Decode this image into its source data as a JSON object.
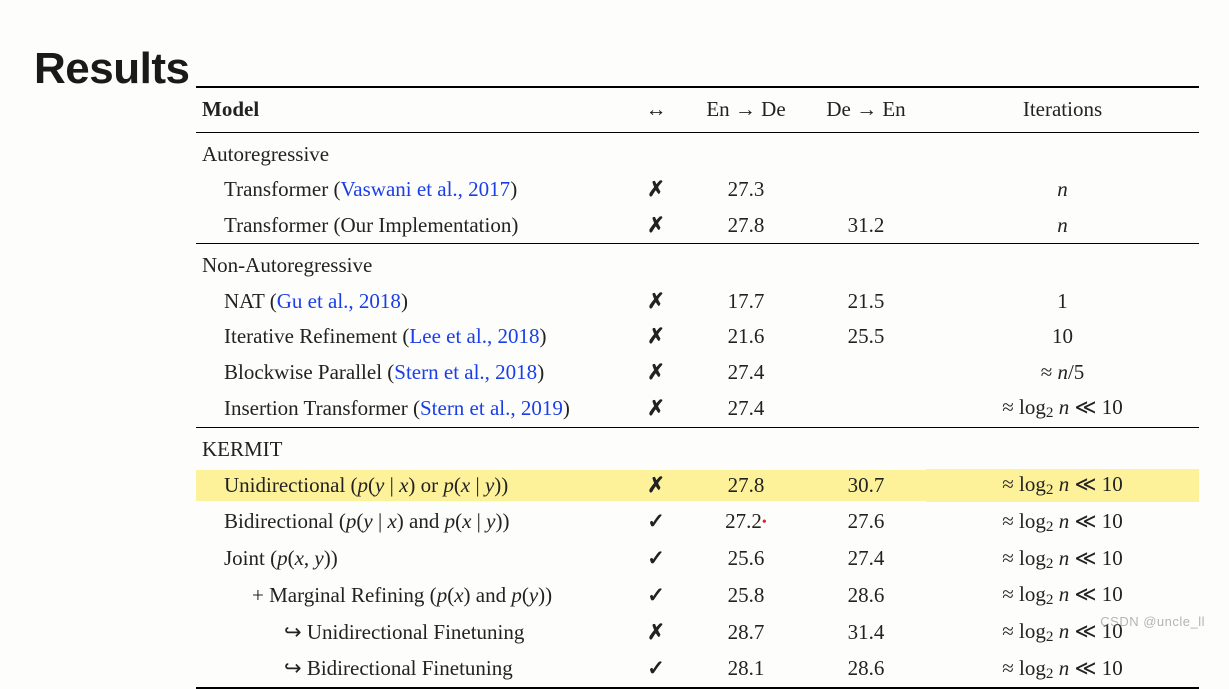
{
  "title": "Results",
  "headers": {
    "model": "Model",
    "sym": "↔",
    "ende": "En → De",
    "deen": "De → En",
    "iter": "Iterations"
  },
  "sections": {
    "autoreg": "Autoregressive",
    "nonautoreg": "Non-Autoregressive",
    "kermit": "KERMIT"
  },
  "rows": {
    "vaswani": {
      "prefix": "Transformer (",
      "cite": "Vaswani et al., 2017",
      "suffix": ")",
      "sym": "✗",
      "ende": "27.3",
      "deen": "",
      "iter": "n"
    },
    "ourimpl": {
      "text": "Transformer (Our Implementation)",
      "sym": "✗",
      "ende": "27.8",
      "deen": "31.2",
      "iter": "n"
    },
    "nat": {
      "prefix": "NAT (",
      "cite": "Gu et al., 2018",
      "suffix": ")",
      "sym": "✗",
      "ende": "17.7",
      "deen": "21.5",
      "iter": "1"
    },
    "iterref": {
      "prefix": "Iterative Refinement (",
      "cite": "Lee et al., 2018",
      "suffix": ")",
      "sym": "✗",
      "ende": "21.6",
      "deen": "25.5",
      "iter": "10"
    },
    "blockwise": {
      "prefix": "Blockwise Parallel (",
      "cite": "Stern et al., 2018",
      "suffix": ")",
      "sym": "✗",
      "ende": "27.4",
      "deen": "",
      "iter_html": "≈ <span class=\"math\">n</span>/5"
    },
    "instrans": {
      "prefix": "Insertion Transformer (",
      "cite": "Stern et al., 2019",
      "suffix": ")",
      "sym": "✗",
      "ende": "27.4",
      "deen": "",
      "iter_html": "≈ log<span class=\"sub\">2</span> <span class=\"math\">n</span> ≪ 10"
    },
    "uni": {
      "label_html": "Unidirectional (<span class=\"math\">p</span>(<span class=\"math\">y</span> | <span class=\"math\">x</span>) or <span class=\"math\">p</span>(<span class=\"math\">x</span> | <span class=\"math\">y</span>))",
      "sym": "✗",
      "ende": "27.8",
      "deen": "30.7",
      "iter_html": "≈ log<span class=\"sub\">2</span> <span class=\"math\">n</span> ≪ 10"
    },
    "bi": {
      "label_html": "Bidirectional (<span class=\"math\">p</span>(<span class=\"math\">y</span> | <span class=\"math\">x</span>) and <span class=\"math\">p</span>(<span class=\"math\">x</span> | <span class=\"math\">y</span>))",
      "sym": "✓",
      "ende": "27.2",
      "deen": "27.6",
      "iter_html": "≈ log<span class=\"sub\">2</span> <span class=\"math\">n</span> ≪ 10"
    },
    "joint": {
      "label_html": "Joint (<span class=\"math\">p</span>(<span class=\"math\">x</span>, <span class=\"math\">y</span>))",
      "sym": "✓",
      "ende": "25.6",
      "deen": "27.4",
      "iter_html": "≈ log<span class=\"sub\">2</span> <span class=\"math\">n</span> ≪ 10"
    },
    "marginal": {
      "label_html": "+ Marginal Refining (<span class=\"math\">p</span>(<span class=\"math\">x</span>) and <span class=\"math\">p</span>(<span class=\"math\">y</span>))",
      "sym": "✓",
      "ende": "25.8",
      "deen": "28.6",
      "iter_html": "≈ log<span class=\"sub\">2</span> <span class=\"math\">n</span> ≪ 10"
    },
    "unift": {
      "text": "↪ Unidirectional Finetuning",
      "sym": "✗",
      "ende": "28.7",
      "deen": "31.4",
      "iter_html": "≈ log<span class=\"sub\">2</span> <span class=\"math\">n</span> ≪ 10"
    },
    "bift": {
      "text": "↪ Bidirectional Finetuning",
      "sym": "✓",
      "ende": "28.1",
      "deen": "28.6",
      "iter_html": "≈ log<span class=\"sub\">2</span> <span class=\"math\">n</span> ≪ 10"
    }
  },
  "watermark": "CSDN @uncle_ll",
  "chart_data": {
    "type": "table",
    "title": "Results",
    "columns": [
      "Model",
      "↔ (bidirectional)",
      "En→De",
      "De→En",
      "Iterations"
    ],
    "groups": [
      {
        "name": "Autoregressive",
        "rows": [
          {
            "model": "Transformer (Vaswani et al., 2017)",
            "bidir": false,
            "en_de": 27.3,
            "de_en": null,
            "iterations": "n"
          },
          {
            "model": "Transformer (Our Implementation)",
            "bidir": false,
            "en_de": 27.8,
            "de_en": 31.2,
            "iterations": "n"
          }
        ]
      },
      {
        "name": "Non-Autoregressive",
        "rows": [
          {
            "model": "NAT (Gu et al., 2018)",
            "bidir": false,
            "en_de": 17.7,
            "de_en": 21.5,
            "iterations": "1"
          },
          {
            "model": "Iterative Refinement (Lee et al., 2018)",
            "bidir": false,
            "en_de": 21.6,
            "de_en": 25.5,
            "iterations": "10"
          },
          {
            "model": "Blockwise Parallel (Stern et al., 2018)",
            "bidir": false,
            "en_de": 27.4,
            "de_en": null,
            "iterations": "≈ n/5"
          },
          {
            "model": "Insertion Transformer (Stern et al., 2019)",
            "bidir": false,
            "en_de": 27.4,
            "de_en": null,
            "iterations": "≈ log2 n ≪ 10"
          }
        ]
      },
      {
        "name": "KERMIT",
        "rows": [
          {
            "model": "Unidirectional (p(y|x) or p(x|y))",
            "bidir": false,
            "en_de": 27.8,
            "de_en": 30.7,
            "iterations": "≈ log2 n ≪ 10",
            "highlighted": true
          },
          {
            "model": "Bidirectional (p(y|x) and p(x|y))",
            "bidir": true,
            "en_de": 27.2,
            "de_en": 27.6,
            "iterations": "≈ log2 n ≪ 10"
          },
          {
            "model": "Joint (p(x,y))",
            "bidir": true,
            "en_de": 25.6,
            "de_en": 27.4,
            "iterations": "≈ log2 n ≪ 10"
          },
          {
            "model": "+ Marginal Refining (p(x) and p(y))",
            "bidir": true,
            "en_de": 25.8,
            "de_en": 28.6,
            "iterations": "≈ log2 n ≪ 10"
          },
          {
            "model": "↪ Unidirectional Finetuning",
            "bidir": false,
            "en_de": 28.7,
            "de_en": 31.4,
            "iterations": "≈ log2 n ≪ 10"
          },
          {
            "model": "↪ Bidirectional Finetuning",
            "bidir": true,
            "en_de": 28.1,
            "de_en": 28.6,
            "iterations": "≈ log2 n ≪ 10"
          }
        ]
      }
    ]
  }
}
